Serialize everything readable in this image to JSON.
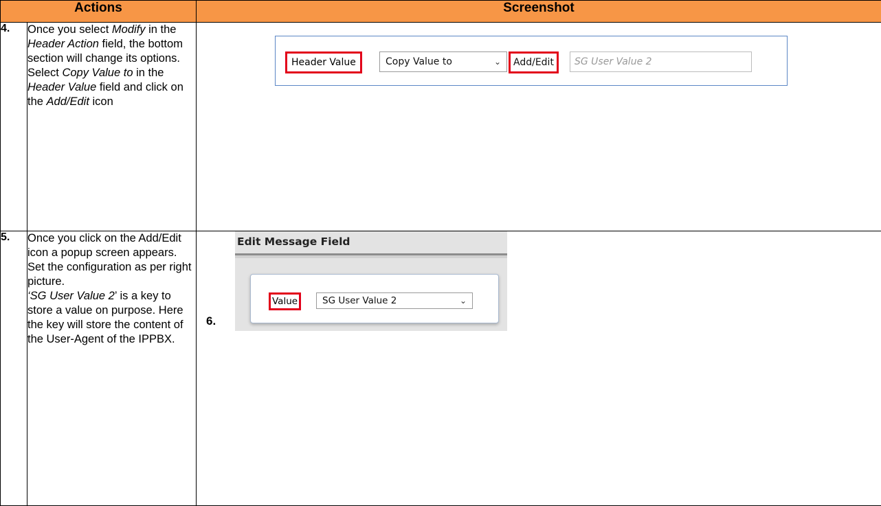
{
  "table": {
    "header_actions": "Actions",
    "header_screenshot": "Screenshot"
  },
  "step4": {
    "number": "4.",
    "parts": [
      "Once you select ",
      "Modify",
      " in the ",
      "Header Action",
      " field, the bottom section will change its options.",
      "Select ",
      "Copy Value to",
      " in the ",
      "Header Value",
      " field and click on the ",
      "Add/Edit",
      " icon"
    ],
    "screenshot": {
      "header_value_label": "Header Value",
      "select_value": "Copy Value to",
      "add_edit_label": "Add/Edit",
      "target_placeholder": "SG User Value 2"
    }
  },
  "step5": {
    "number": "5.",
    "parts": [
      "Once you click on the Add/Edit icon a popup screen appears.",
      "Set the configuration as per right picture.",
      "‘SG User Value 2",
      "’ is a key to store  a value on purpose. Here the key will store the content of the User-Agent of the IPPBX."
    ]
  },
  "step6": {
    "number": "6.",
    "screenshot": {
      "title": "Edit Message Field",
      "value_label": "Value",
      "select_value": "SG User Value 2"
    }
  },
  "icons": {
    "dropdown": "chevron-down-icon"
  },
  "colors": {
    "header_bg": "#f79646",
    "highlight": "#e2001a",
    "frame": "#5b86c5"
  }
}
